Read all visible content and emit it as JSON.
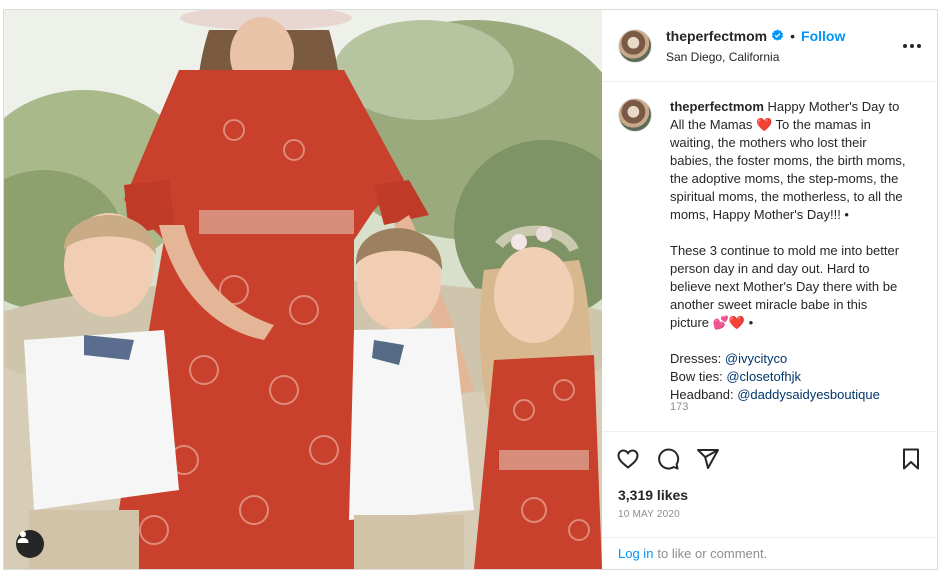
{
  "post": {
    "username": "theperfectmom",
    "verified_badge": "verified-badge-icon",
    "separator": "•",
    "follow_label": "Follow",
    "location": "San Diego, California",
    "more_icon": "more-options-icon",
    "user_tag_icon": "user-tag-icon"
  },
  "caption": {
    "username": "theperfectmom",
    "paragraph1": "Happy Mother's Day to All the Mamas ❤️ To the mamas in waiting, the mothers who lost their babies, the foster moms, the birth moms, the adoptive moms, the step-moms, the spiritual moms, the motherless, to all the moms, Happy Mother's Day!!! •",
    "paragraph2": "These 3 continue to mold me into better person day in and day out. Hard to believe next Mother's Day there with be another sweet miracle babe in this picture 💕❤️ •",
    "dresses_label": "Dresses: ",
    "dresses_mention": "@ivycityco",
    "bowties_label": "Bow ties: ",
    "bowties_mention": "@closetofhjk",
    "headband_label": "Headband: ",
    "headband_mention": "@daddysaidyesboutique",
    "truncated": "173"
  },
  "actions": {
    "like_icon": "heart-icon",
    "comment_icon": "comment-icon",
    "share_icon": "share-icon",
    "save_icon": "bookmark-icon"
  },
  "likes": "3,319 likes",
  "date": "10 MAY 2020",
  "login": {
    "link": "Log in",
    "rest": "to like or comment."
  },
  "colors": {
    "accent": "#0095f6",
    "mention": "#00376b",
    "dress": "#c9402c"
  }
}
